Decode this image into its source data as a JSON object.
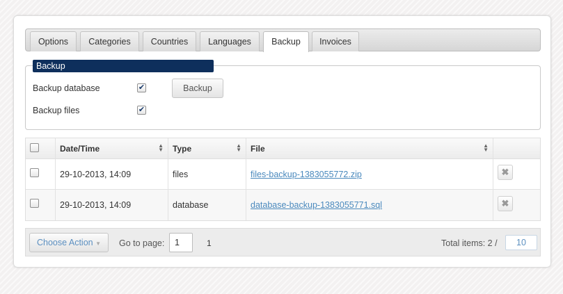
{
  "tabs": [
    {
      "label": "Options",
      "active": false
    },
    {
      "label": "Categories",
      "active": false
    },
    {
      "label": "Countries",
      "active": false
    },
    {
      "label": "Languages",
      "active": false
    },
    {
      "label": "Backup",
      "active": true
    },
    {
      "label": "Invoices",
      "active": false
    }
  ],
  "backup": {
    "legend": "Backup",
    "database_label": "Backup database",
    "database_checked": true,
    "files_label": "Backup files",
    "files_checked": true,
    "button_label": "Backup"
  },
  "table": {
    "columns": [
      "",
      "Date/Time",
      "Type",
      "File",
      ""
    ],
    "rows": [
      {
        "checked": false,
        "datetime": "29-10-2013, 14:09",
        "type": "files",
        "file": "files-backup-1383055772.zip"
      },
      {
        "checked": false,
        "datetime": "29-10-2013, 14:09",
        "type": "database",
        "file": "database-backup-1383055771.sql"
      }
    ]
  },
  "footer": {
    "choose_action": "Choose Action",
    "go_to_page_label": "Go to page:",
    "page_input_value": "1",
    "current_page": "1",
    "total_items_label": "Total items: 2 /",
    "per_page": "10"
  },
  "icons": {
    "checkmark": "✔",
    "delete": "✖",
    "sort": "sort-arrows-icon",
    "dropdown": "caret-down-icon"
  },
  "colors": {
    "legend_bg": "#0e2f5c",
    "link": "#4a89bd"
  }
}
